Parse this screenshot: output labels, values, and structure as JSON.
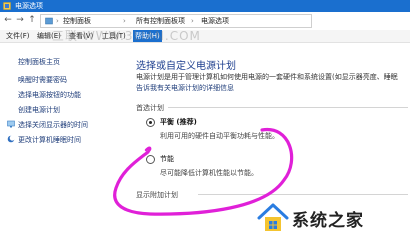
{
  "window": {
    "title": "电源选项"
  },
  "address_bar": {
    "back": "←",
    "forward": "→",
    "up": "↑",
    "crumbs": [
      "控制面板",
      "所有控制面板项",
      "电源选项"
    ],
    "separator": "›"
  },
  "menubar": {
    "items": [
      "文件(F)",
      "编辑(E)",
      "查看(V)",
      "工具(T)",
      "帮助(H)"
    ],
    "active_index": 4
  },
  "watermark": {
    "text": "三联 WWW.3LIAN.COM"
  },
  "sidebar": {
    "links": [
      "控制面板主页",
      "唤醒时需要密码",
      "选择电源按钮的功能",
      "创建电源计划",
      "选择关闭显示器的时间",
      "更改计算机睡眠时间"
    ]
  },
  "main": {
    "heading": "选择或自定义电源计划",
    "description": "电源计划是用于管理计算机如何使用电源的一套硬件和系统设置(如显示器亮度、睡眠",
    "learn_more": "告诉我有关电源计划的详细信息",
    "preferred_label": "首选计划",
    "plans": [
      {
        "name": "平衡 (推荐)",
        "desc": "利用可用的硬件自动平衡功耗与性能。",
        "selected": true
      },
      {
        "name": "节能",
        "desc": "尽可能降低计算机性能以节能。",
        "selected": false
      }
    ],
    "additional_label": "显示附加计划"
  },
  "logo": {
    "text": "系统之家"
  },
  "colors": {
    "accent": "#1a6fcf",
    "link": "#1f3d7a",
    "annotation": "#e020d8"
  }
}
